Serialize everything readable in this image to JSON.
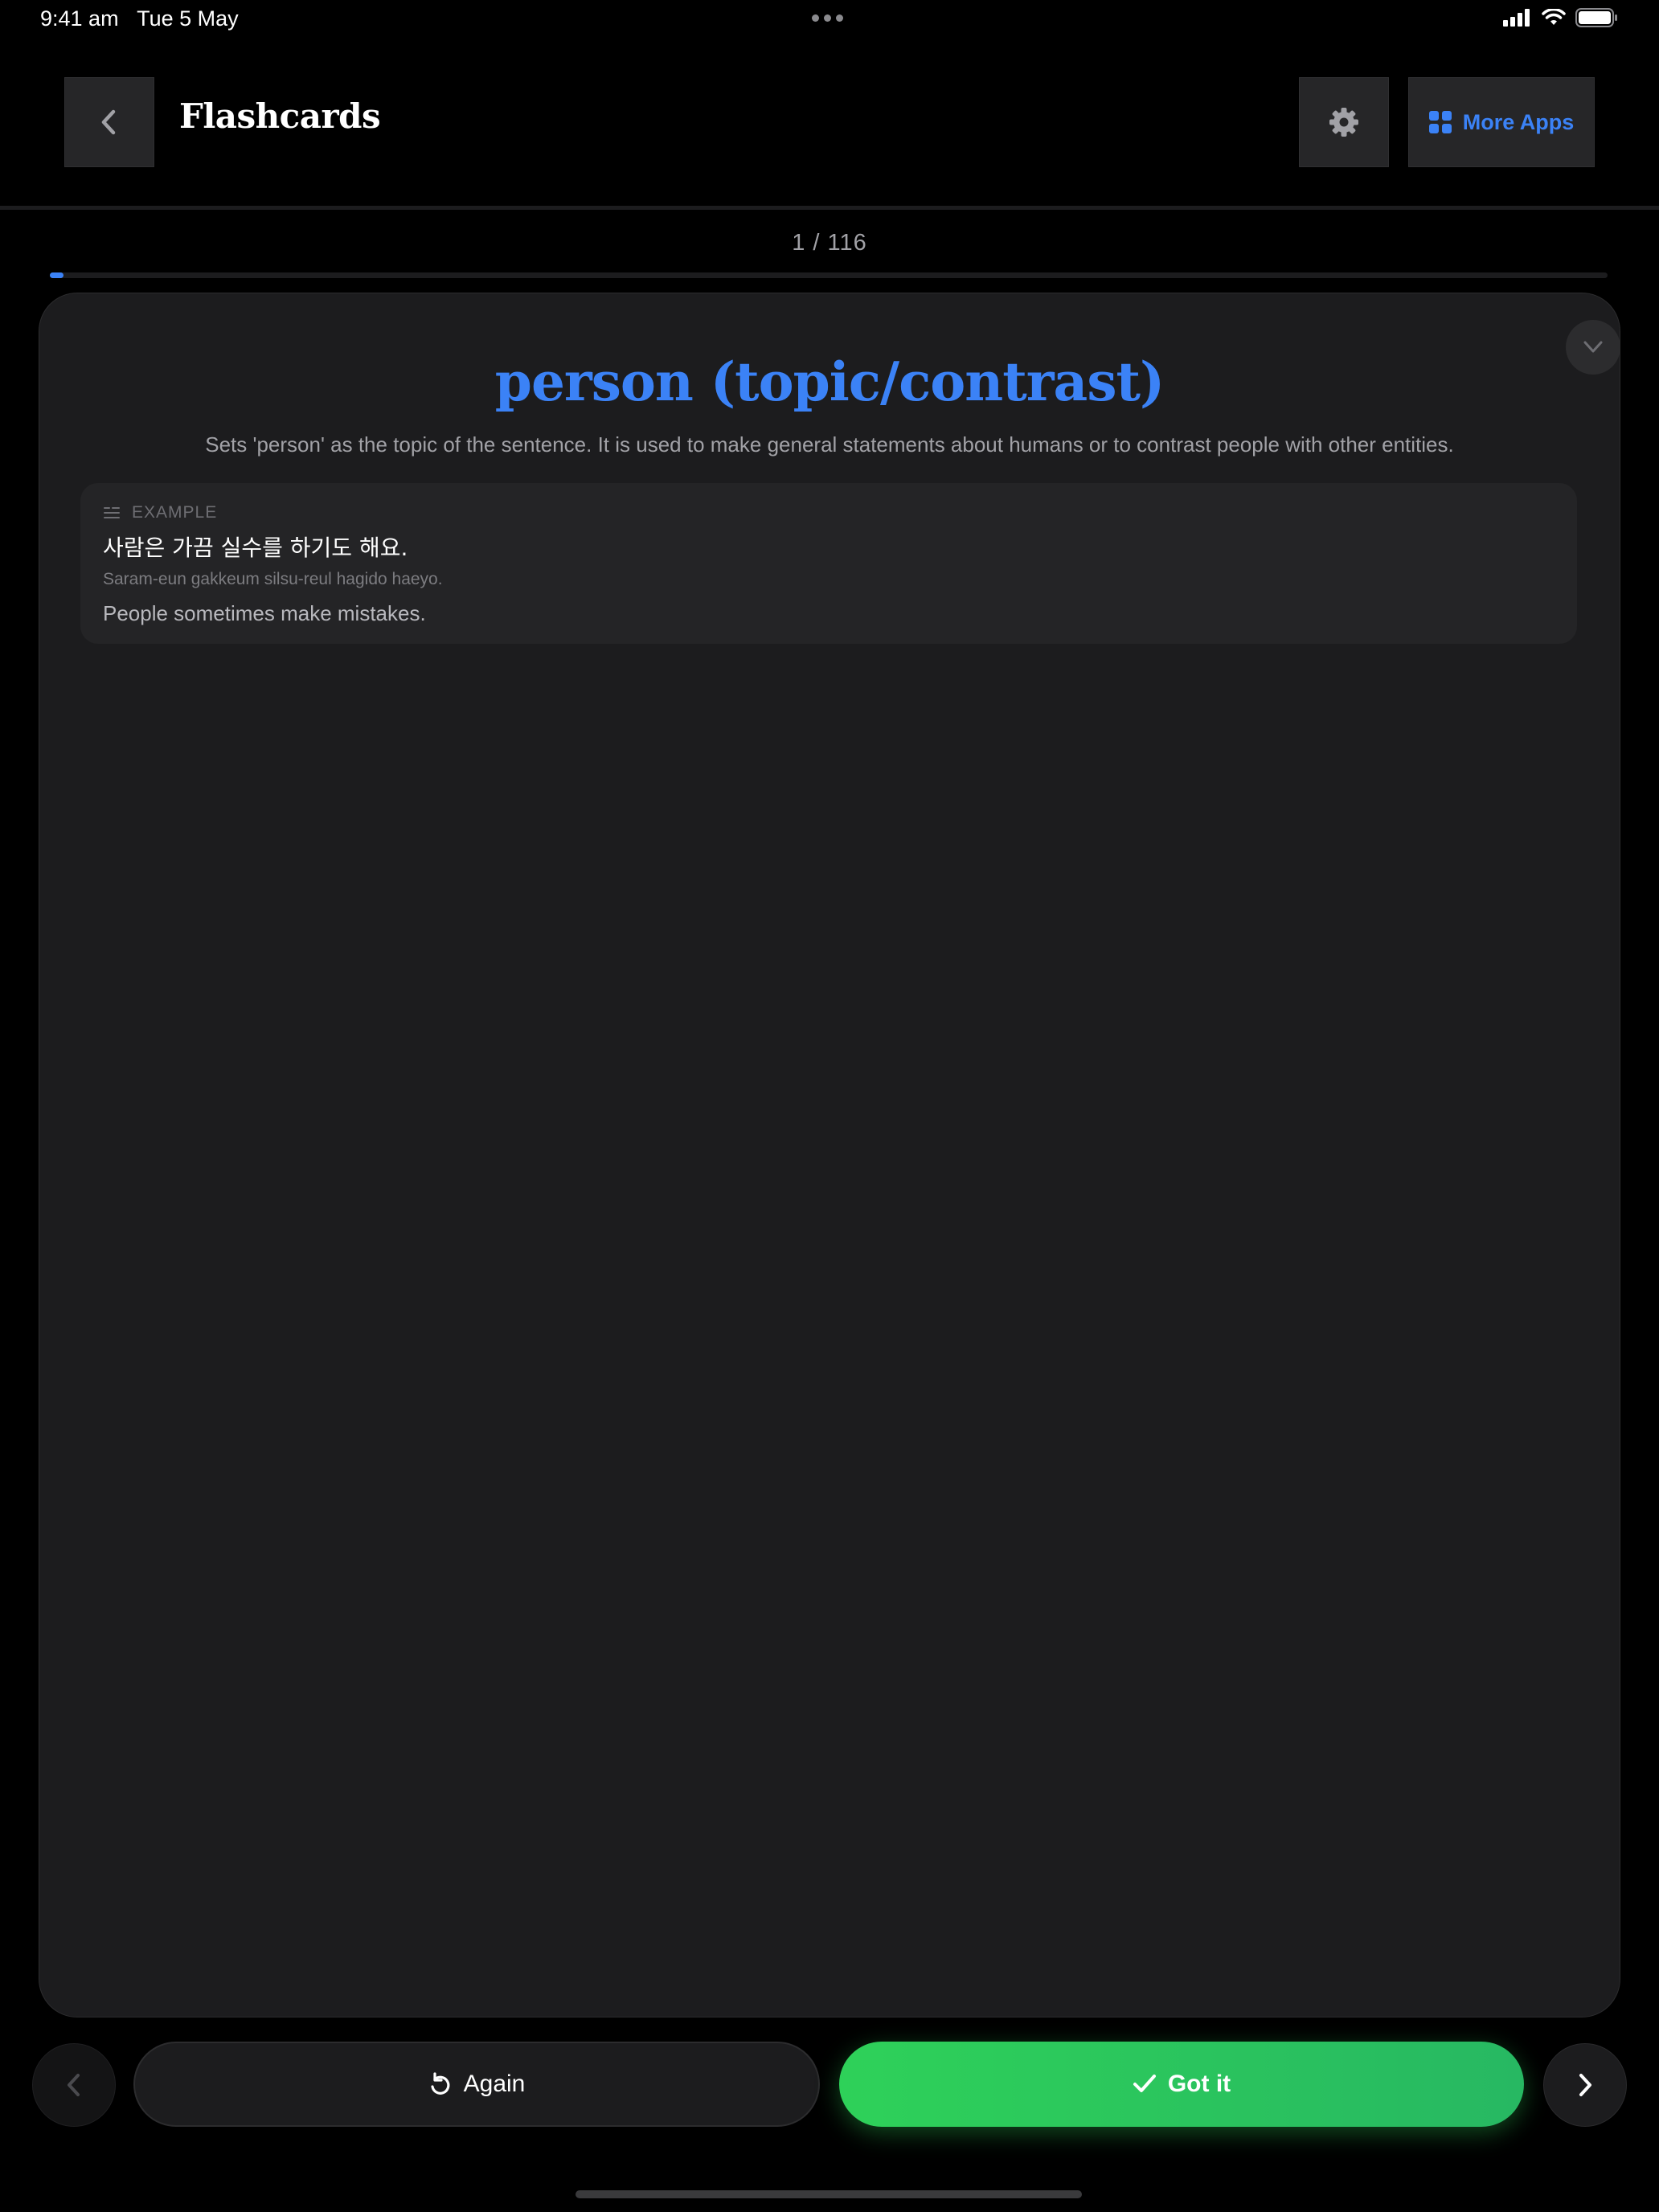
{
  "status_bar": {
    "time": "9:41 am",
    "date": "Tue 5 May"
  },
  "header": {
    "title": "Flashcards",
    "more_apps_label": "More Apps",
    "icons": {
      "back": "chevron-left-icon",
      "settings": "gear-icon",
      "more_apps": "grid-icon"
    }
  },
  "progress": {
    "counter": "1 / 116",
    "current": 1,
    "total": 116
  },
  "card": {
    "title": "person (topic/contrast)",
    "description": "Sets 'person' as the topic of the sentence. It is used to make general statements about humans or to contrast people with other entities.",
    "example": {
      "label": "EXAMPLE",
      "korean": "사람은 가끔 실수를 하기도 해요.",
      "romanization": "Saram-eun gakkeum silsu-reul hagido haeyo.",
      "english": "People sometimes make mistakes."
    }
  },
  "controls": {
    "again_label": "Again",
    "got_it_label": "Got it"
  },
  "colors": {
    "accent": "#3b82f6",
    "success": "#2ed159",
    "background": "#000000",
    "card": "#1c1c1e"
  }
}
